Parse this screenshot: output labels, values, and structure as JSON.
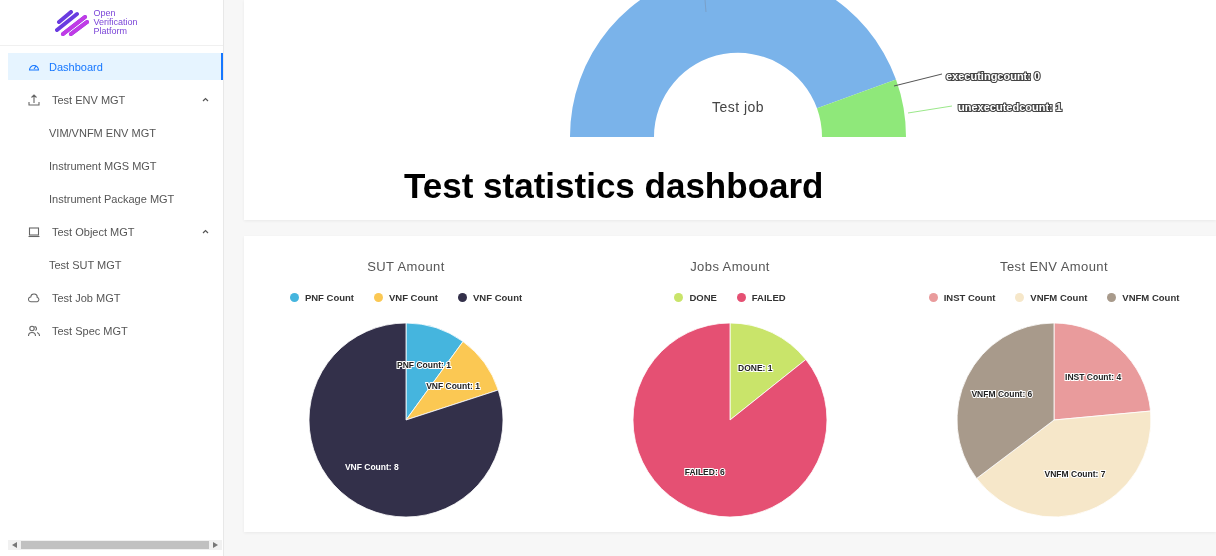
{
  "sidebar": {
    "logo_text": "Open Verification Platform",
    "items": [
      {
        "label": "Dashboard",
        "selected": true
      },
      {
        "label": "Test ENV MGT",
        "selected": false,
        "expanded": true,
        "children": [
          {
            "label": "VIM/VNFM ENV MGT",
            "selected": false
          },
          {
            "label": "Instrument MGS MGT",
            "selected": false
          },
          {
            "label": "Instrument Package MGT",
            "selected": false
          }
        ]
      },
      {
        "label": "Test Object MGT",
        "selected": false,
        "expanded": true,
        "children": [
          {
            "label": "Test SUT MGT",
            "selected": false
          }
        ]
      },
      {
        "label": "Test Job MGT",
        "selected": false
      },
      {
        "label": "Test Spec MGT",
        "selected": false
      }
    ]
  },
  "job_panel": {
    "center_label": "Test job",
    "labels": [
      "executingcount: 0",
      "unexecutedcount: 1"
    ],
    "caption": "Test statistics dashboard"
  },
  "charts": [
    {
      "chart_data": {
        "type": "pie",
        "title": "SUT Amount",
        "categories": [
          "PNF Count",
          "VNF Count",
          "VNF Count"
        ],
        "values": [
          1,
          1,
          8
        ],
        "colors": [
          "#45b5de",
          "#fbc853",
          "#33304a"
        ],
        "value_labels": [
          "PNF Count: 1",
          "VNF Count: 1",
          "VNF Count: 8"
        ]
      }
    },
    {
      "chart_data": {
        "type": "pie",
        "title": "Jobs Amount",
        "categories": [
          "DONE",
          "FAILED"
        ],
        "values": [
          1,
          6
        ],
        "colors": [
          "#c9e46a",
          "#e55073"
        ],
        "value_labels": [
          "DONE: 1",
          "FAILED: 6"
        ]
      }
    },
    {
      "chart_data": {
        "type": "pie",
        "title": "Test ENV Amount",
        "categories": [
          "INST Count",
          "VNFM Count",
          "VNFM Count"
        ],
        "values": [
          4,
          7,
          6
        ],
        "colors": [
          "#e99b9c",
          "#f6e7c9",
          "#a89a8b"
        ],
        "value_labels": [
          "INST Count: 4",
          "VNFM Count: 7",
          "VNFM Count: 6"
        ]
      }
    }
  ]
}
